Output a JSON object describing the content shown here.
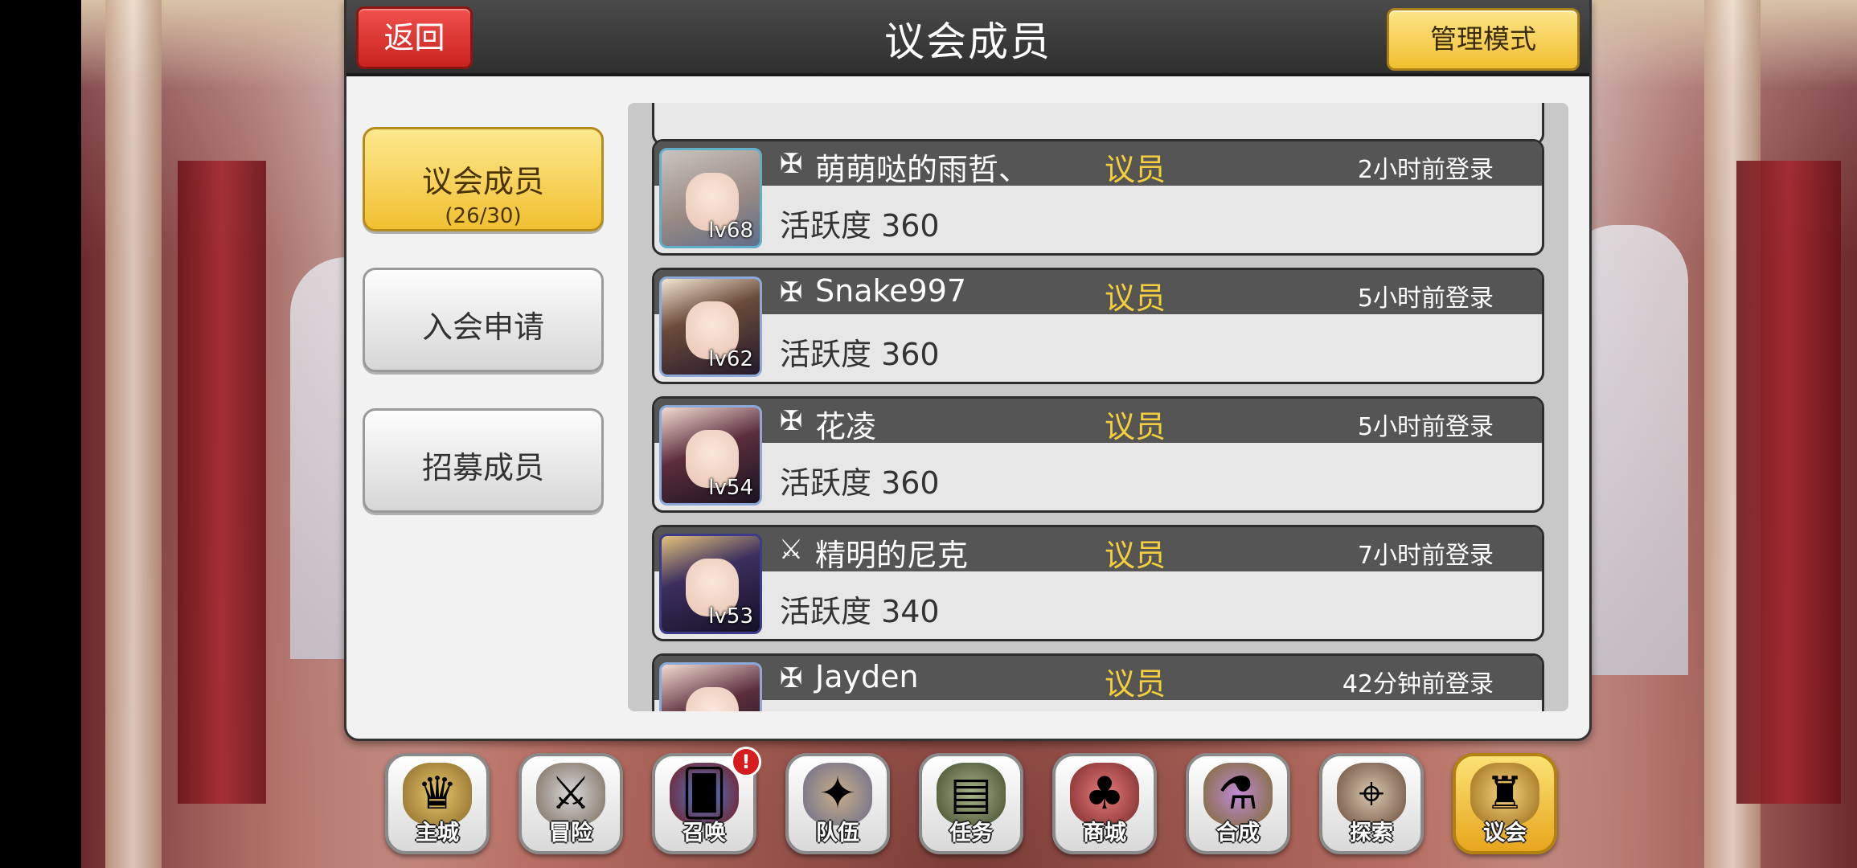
{
  "header": {
    "title": "议会成员",
    "back_label": "返回",
    "manage_label": "管理模式"
  },
  "tabs": [
    {
      "label": "议会成员",
      "sub": "(26/30)",
      "active": true
    },
    {
      "label": "入会申请"
    },
    {
      "label": "招募成员"
    }
  ],
  "members": [
    {
      "name": "萌萌哒的雨哲、",
      "role": "议员",
      "login": "2小时前登录",
      "activity": "活跃度 360",
      "level": "lv68",
      "rank_icon": "cross-icon"
    },
    {
      "name": "Snake997",
      "role": "议员",
      "login": "5小时前登录",
      "activity": "活跃度 360",
      "level": "lv62",
      "rank_icon": "cross-icon"
    },
    {
      "name": "花凌",
      "role": "议员",
      "login": "5小时前登录",
      "activity": "活跃度 360",
      "level": "lv54",
      "rank_icon": "cross-icon"
    },
    {
      "name": "精明的尼克",
      "role": "议员",
      "login": "7小时前登录",
      "activity": "活跃度 340",
      "level": "lv53",
      "rank_icon": "sword-icon"
    },
    {
      "name": "Jayden",
      "role": "议员",
      "login": "42分钟前登录",
      "activity": "",
      "level": "",
      "rank_icon": "cross-icon"
    }
  ],
  "bottom_nav": [
    {
      "label": "主城",
      "icon": "crown-icon"
    },
    {
      "label": "冒险",
      "icon": "swords-icon"
    },
    {
      "label": "召唤",
      "icon": "card-icon",
      "badge": "!"
    },
    {
      "label": "队伍",
      "icon": "wings-icon"
    },
    {
      "label": "任务",
      "icon": "book-icon"
    },
    {
      "label": "商城",
      "icon": "shop-icon"
    },
    {
      "label": "合成",
      "icon": "potion-icon"
    },
    {
      "label": "探索",
      "icon": "compass-icon"
    },
    {
      "label": "议会",
      "icon": "council-icon",
      "active": true
    }
  ],
  "colors": {
    "accent_yellow": "#f1c030",
    "back_red": "#d9302c",
    "role_yellow": "#f5cf3a"
  }
}
